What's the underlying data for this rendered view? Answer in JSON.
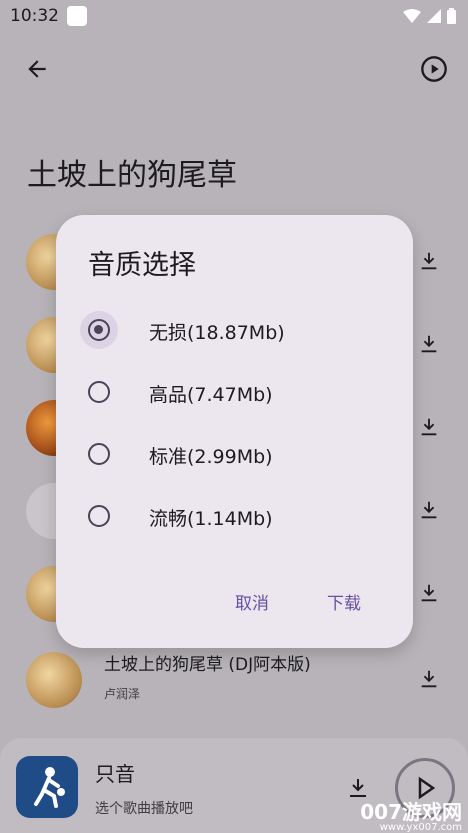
{
  "status": {
    "time": "10:32"
  },
  "page": {
    "title": "土坡上的狗尾草"
  },
  "list": {
    "visible_row": {
      "title": "土坡上的狗尾草 (DJ阿本版)",
      "artist": "卢润泽"
    }
  },
  "dialog": {
    "title": "音质选择",
    "options": [
      {
        "label": "无损(18.87Mb)",
        "selected": true
      },
      {
        "label": "高品(7.47Mb)",
        "selected": false
      },
      {
        "label": "标准(2.99Mb)",
        "selected": false
      },
      {
        "label": "流畅(1.14Mb)",
        "selected": false
      }
    ],
    "cancel": "取消",
    "confirm": "下载"
  },
  "player": {
    "title": "只音",
    "subtitle": "选个歌曲播放吧"
  },
  "watermark": {
    "main": "007游戏网",
    "url": "www.yx007.com"
  },
  "colors": {
    "accent": "#6750a4",
    "dialog_bg": "#ece6ee"
  }
}
